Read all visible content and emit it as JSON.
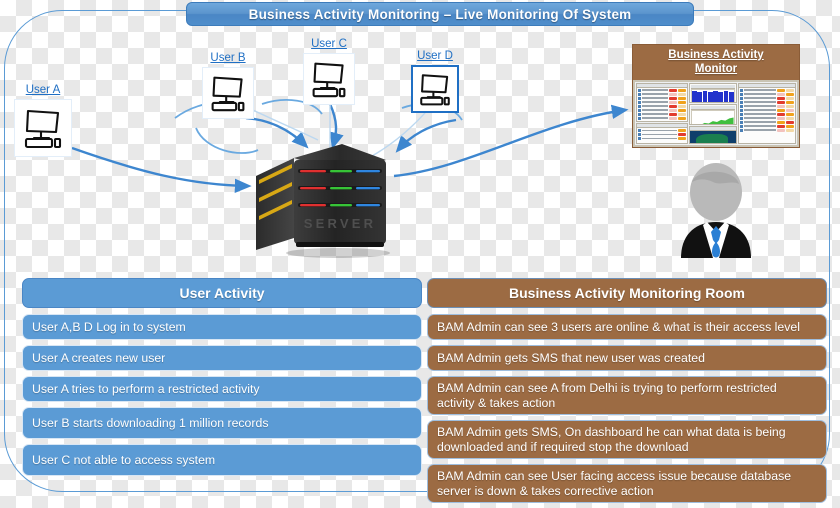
{
  "title": "Business Activity Monitoring – Live Monitoring Of System",
  "diagram": {
    "users": [
      {
        "label": "User A",
        "icon": "desktop-computer-icon"
      },
      {
        "label": "User B",
        "icon": "desktop-computer-icon"
      },
      {
        "label": "User C",
        "icon": "desktop-computer-icon"
      },
      {
        "label": "User D",
        "icon": "desktop-computer-icon"
      }
    ],
    "server": {
      "label": "SERVER",
      "icon": "server-rack-icon"
    },
    "monitor": {
      "title_line1": "Business Activity",
      "title_line2": "Monitor",
      "icon": "dashboard-screen-icon"
    },
    "admin": {
      "icon": "admin-avatar-icon"
    }
  },
  "tables": {
    "user_activity": {
      "header": "User Activity",
      "rows": [
        "User A,B D   Log in to system",
        "User A   creates new user",
        "User A tries to perform a restricted activity",
        "User  B  starts  downloading 1 million records",
        "User  C  not able to access system"
      ]
    },
    "bam_room": {
      "header": "Business Activity Monitoring Room",
      "rows": [
        "BAM Admin can see 3 users are online & what is their access level",
        "BAM Admin  gets  SMS that new user was created",
        "BAM Admin can see A from Delhi is trying to perform restricted activity & takes action",
        "BAM Admin  gets  SMS, On  dashboard he can what data is being downloaded and if required stop the download",
        "BAM Admin  can see User facing access issue because  database server is down & takes corrective action"
      ]
    }
  },
  "colors": {
    "blue": "#5b9bd5",
    "brown": "#9c6b43",
    "link_blue": "#1f6fc4",
    "arrow_blue": "#4a90d9"
  }
}
